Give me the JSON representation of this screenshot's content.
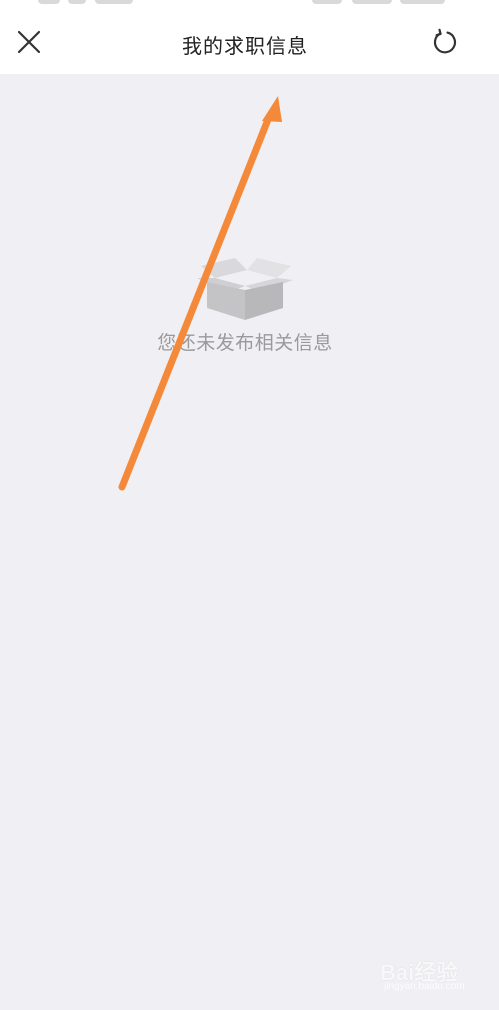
{
  "header": {
    "title": "我的求职信息",
    "close_icon": "close-icon",
    "refresh_icon": "refresh-icon"
  },
  "empty_state": {
    "icon": "empty-box-icon",
    "message": "您还未发布相关信息"
  },
  "annotation": {
    "type": "arrow",
    "color": "#f5893a"
  },
  "watermark": {
    "brand": "Bai经验",
    "url": "jingyan.baidu.com"
  },
  "colors": {
    "background": "#efeff4",
    "header_background": "#ffffff",
    "title_text": "#222222",
    "empty_text": "#9a9a9a",
    "arrow": "#f5893a"
  }
}
